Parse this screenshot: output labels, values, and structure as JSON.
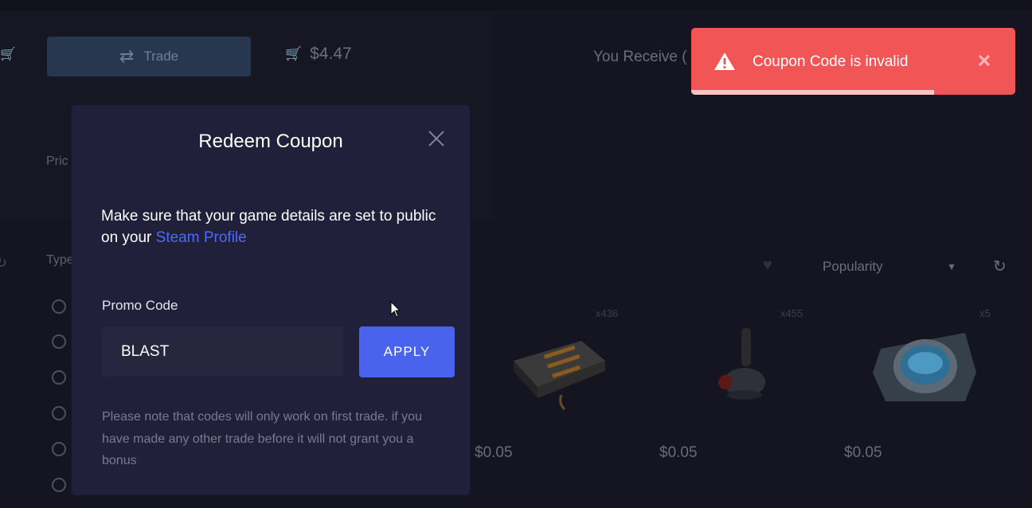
{
  "background": {
    "trade_button_label": "Trade",
    "cart_total": "$4.47",
    "receive_label": "You Receive (",
    "price_label": "Pric",
    "type_label": "Type",
    "sort": {
      "selected": "Popularity"
    },
    "items": [
      {
        "count": "x436",
        "price": "$0.05"
      },
      {
        "count": "x455",
        "price": "$0.05"
      },
      {
        "count": "x5",
        "price": "$0.05"
      }
    ],
    "first_item_price": "$0.05"
  },
  "modal": {
    "title": "Redeem Coupon",
    "message_prefix": "Make sure that your game details are set to public on your ",
    "message_link": "Steam Profile",
    "promo_label": "Promo Code",
    "promo_value": "BLAST",
    "apply_label": "APPLY",
    "note": "Please note that codes will only work on first trade. if you have made any other trade before it will not grant you a bonus"
  },
  "toast": {
    "message": "Coupon Code is invalid",
    "progress": 0.75,
    "color": "#f25556"
  },
  "colors": {
    "accent": "#4a63ef",
    "link": "#4a6cf7",
    "modal_bg": "#20203a",
    "page_bg": "#151522"
  }
}
